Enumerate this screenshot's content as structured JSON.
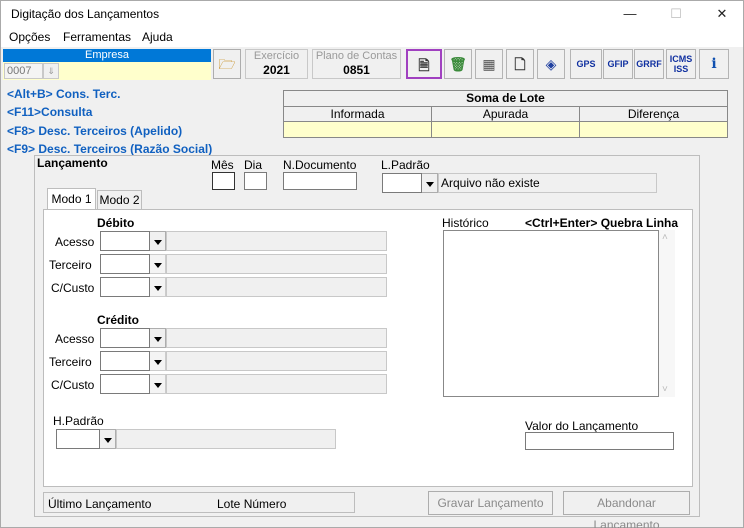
{
  "window": {
    "title": "Digitação dos Lançamentos",
    "minimize": "—",
    "maximize": "☐",
    "close": "✕"
  },
  "menu": [
    "Opções",
    "Ferramentas",
    "Ajuda"
  ],
  "empresa": {
    "label": "Empresa",
    "code": "0007"
  },
  "exercicio": {
    "label": "Exercício",
    "value": "2021"
  },
  "plano": {
    "label": "Plano de Contas",
    "value": "0851"
  },
  "toolbar": {
    "gps": "GPS",
    "gfip": "GFIP",
    "grrf": "GRRF",
    "icms": "ICMS ISS",
    "info": "i"
  },
  "shortcuts": [
    "<Alt+B> Cons. Terc.",
    "<F11>Consulta",
    "<F8> Desc. Terceiros (Apelido)",
    "<F9> Desc. Terceiros (Razão Social)"
  ],
  "lote": {
    "title": "Soma de Lote",
    "cols": [
      "Informada",
      "Apurada",
      "Diferença"
    ]
  },
  "lancamento": {
    "title": "Lançamento",
    "mes": "Mês",
    "dia": "Dia",
    "ndoc": "N.Documento",
    "lpadrao": "L.Padrão",
    "lpadrao_desc": "Arquivo não existe"
  },
  "tabs": [
    "Modo 1",
    "Modo 2"
  ],
  "debito": {
    "title": "Débito",
    "acesso": "Acesso",
    "terceiro": "Terceiro",
    "ccusto": "C/Custo"
  },
  "credito": {
    "title": "Crédito",
    "acesso": "Acesso",
    "terceiro": "Terceiro",
    "ccusto": "C/Custo"
  },
  "historico": {
    "label": "Histórico",
    "hint": "<Ctrl+Enter> Quebra Linha"
  },
  "hpadrao": "H.Padrão",
  "valor": "Valor do Lançamento",
  "status": {
    "ultimo": "Último Lançamento",
    "lote": "Lote Número"
  },
  "buttons": {
    "gravar": "Gravar Lançamento",
    "abandonar": "Abandonar Lançamento"
  },
  "colors": {
    "accent_blue": "#0078d7",
    "yellow": "#ffffcc",
    "shortcut_blue": "#1060c0",
    "highlight_purple": "#a040c0"
  }
}
